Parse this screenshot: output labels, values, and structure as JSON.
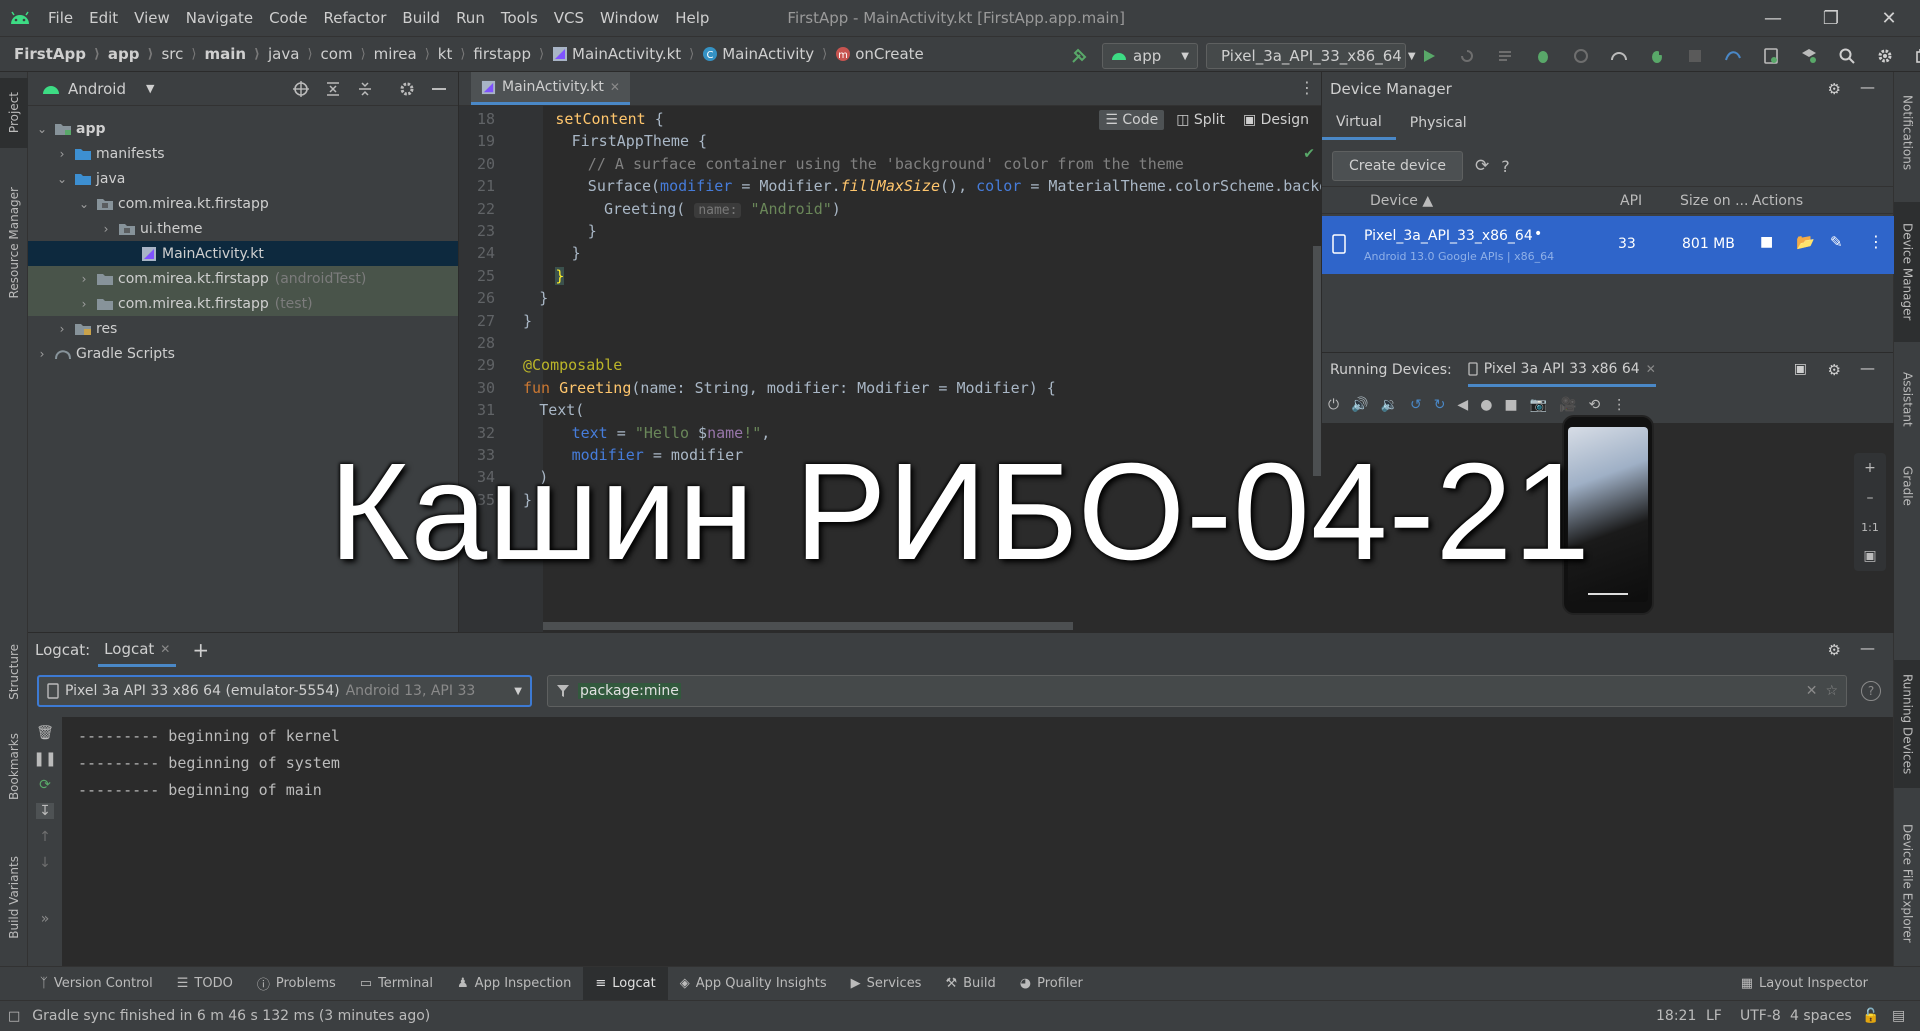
{
  "menu": {
    "items": [
      "File",
      "Edit",
      "View",
      "Navigate",
      "Code",
      "Refactor",
      "Build",
      "Run",
      "Tools",
      "VCS",
      "Window",
      "Help"
    ],
    "window_title": "FirstApp - MainActivity.kt [FirstApp.app.main]"
  },
  "breadcrumbs": [
    "FirstApp",
    "app",
    "src",
    "main",
    "java",
    "com",
    "mirea",
    "kt",
    "firstapp",
    "MainActivity.kt",
    "MainActivity",
    "onCreate"
  ],
  "toolbar": {
    "run_config": "app",
    "device": "Pixel_3a_API_33_x86_64"
  },
  "project": {
    "view": "Android",
    "tree": [
      {
        "label": "app",
        "suffix": ""
      },
      {
        "label": "manifests",
        "suffix": ""
      },
      {
        "label": "java",
        "suffix": ""
      },
      {
        "label": "com.mirea.kt.firstapp",
        "suffix": ""
      },
      {
        "label": "ui.theme",
        "suffix": ""
      },
      {
        "label": "MainActivity.kt",
        "suffix": ""
      },
      {
        "label": "com.mirea.kt.firstapp",
        "suffix": "(androidTest)"
      },
      {
        "label": "com.mirea.kt.firstapp",
        "suffix": "(test)"
      },
      {
        "label": "res",
        "suffix": ""
      },
      {
        "label": "Gradle Scripts",
        "suffix": ""
      }
    ]
  },
  "left_stripe": [
    "Project",
    "Resource Manager",
    "Structure",
    "Bookmarks",
    "Build Variants"
  ],
  "right_stripe": [
    "Notifications",
    "Device Manager",
    "Assistant",
    "Gradle",
    "Running Devices",
    "Device File Explorer"
  ],
  "editor": {
    "tab": "MainActivity.kt",
    "view_modes": [
      "Code",
      "Split",
      "Design"
    ],
    "lines": [
      {
        "n": "18",
        "indent": 4,
        "tokens": [
          [
            "fn",
            "setContent "
          ],
          [
            "txt",
            "{"
          ]
        ]
      },
      {
        "n": "19",
        "indent": 6,
        "tokens": [
          [
            "txt",
            "FirstAppTheme {"
          ]
        ]
      },
      {
        "n": "20",
        "indent": 8,
        "tokens": [
          [
            "com",
            "// A surface container using the 'background' color from the theme"
          ]
        ]
      },
      {
        "n": "21",
        "indent": 8,
        "tokens": [
          [
            "txt",
            "Surface("
          ],
          [
            "par",
            "modifier"
          ],
          [
            "txt",
            " = Modifier."
          ],
          [
            "fni",
            "fillMaxSize"
          ],
          [
            "txt",
            "(), "
          ],
          [
            "par",
            "color"
          ],
          [
            "txt",
            " = MaterialTheme.colorScheme.background) {"
          ]
        ]
      },
      {
        "n": "22",
        "indent": 10,
        "tokens": [
          [
            "txt",
            "Greeting( "
          ],
          [
            "hint",
            "name:"
          ],
          [
            "str",
            " \"Android\""
          ],
          [
            "txt",
            ")"
          ]
        ]
      },
      {
        "n": "23",
        "indent": 8,
        "tokens": [
          [
            "txt",
            "}"
          ]
        ]
      },
      {
        "n": "24",
        "indent": 6,
        "tokens": [
          [
            "txt",
            "}"
          ]
        ]
      },
      {
        "n": "25",
        "indent": 4,
        "tokens": [
          [
            "brace",
            "}"
          ]
        ]
      },
      {
        "n": "26",
        "indent": 2,
        "tokens": [
          [
            "txt",
            "}"
          ]
        ]
      },
      {
        "n": "27",
        "indent": 0,
        "tokens": [
          [
            "txt",
            "}"
          ]
        ]
      },
      {
        "n": "28",
        "indent": 0,
        "tokens": []
      },
      {
        "n": "29",
        "indent": 0,
        "tokens": [
          [
            "ann",
            "@Composable"
          ]
        ]
      },
      {
        "n": "30",
        "indent": 0,
        "tokens": [
          [
            "kw",
            "fun "
          ],
          [
            "fn",
            "Greeting"
          ],
          [
            "txt",
            "(name: String, modifier: Modifier = Modifier) {"
          ]
        ]
      },
      {
        "n": "31",
        "indent": 2,
        "tokens": [
          [
            "txt",
            "Text("
          ]
        ]
      },
      {
        "n": "32",
        "indent": 6,
        "tokens": [
          [
            "par",
            "text"
          ],
          [
            "txt",
            " = "
          ],
          [
            "str",
            "\"Hello "
          ],
          [
            "txt",
            "$"
          ],
          [
            "fld",
            "name"
          ],
          [
            "str",
            "!\""
          ],
          [
            "txt",
            ","
          ]
        ]
      },
      {
        "n": "33",
        "indent": 6,
        "tokens": [
          [
            "par",
            "modifier"
          ],
          [
            "txt",
            " = modifier"
          ]
        ]
      },
      {
        "n": "34",
        "indent": 2,
        "tokens": [
          [
            "txt",
            ")"
          ]
        ]
      },
      {
        "n": "35",
        "indent": 0,
        "tokens": [
          [
            "txt",
            "}"
          ]
        ]
      }
    ]
  },
  "device_manager": {
    "title": "Device Manager",
    "tabs": [
      "Virtual",
      "Physical"
    ],
    "create_button": "Create device",
    "columns": [
      "Device",
      "API",
      "Size on ...",
      "Actions"
    ],
    "device": {
      "name": "Pixel_3a_API_33_x86_64",
      "details": "Android 13.0 Google APIs | x86_64",
      "api": "33",
      "size": "801 MB"
    }
  },
  "running_devices": {
    "label": "Running Devices:",
    "tab": "Pixel 3a API 33 x86 64",
    "zoom_label": "1:1"
  },
  "logcat": {
    "title": "Logcat:",
    "tab": "Logcat",
    "device_select": "Pixel 3a API 33 x86 64 (emulator-5554)",
    "device_detail": "Android 13, API 33",
    "filter": "package:mine",
    "lines": [
      "--------- beginning of kernel",
      "--------- beginning of system",
      "--------- beginning of main"
    ]
  },
  "bottom_tools": [
    "Version Control",
    "TODO",
    "Problems",
    "Terminal",
    "App Inspection",
    "Logcat",
    "App Quality Insights",
    "Services",
    "Build",
    "Profiler"
  ],
  "layout_inspector": "Layout Inspector",
  "status": {
    "message": "Gradle sync finished in 6 m 46 s 132 ms (3 minutes ago)",
    "position": "18:21",
    "line_sep": "LF",
    "encoding": "UTF-8",
    "indent": "4 spaces"
  },
  "overlay": "Кашин РИБО-04-21",
  "colors": {
    "accent": "#4a88c7",
    "selection": "#2f65ca",
    "run_green": "#59a869"
  }
}
